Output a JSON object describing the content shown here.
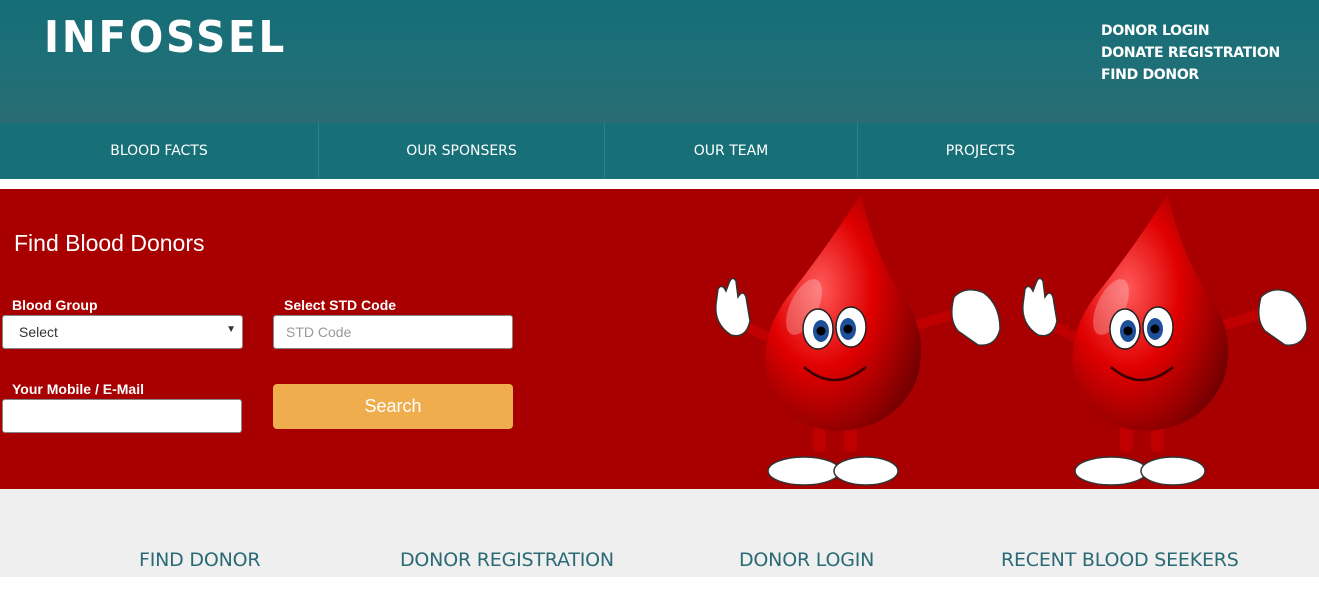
{
  "brand": {
    "logo_text": "INFOSSEL"
  },
  "top_links": [
    "DONOR LOGIN",
    "DONATE REGISTRATION",
    "FIND DONOR"
  ],
  "nav": [
    "BLOOD FACTS",
    "OUR SPONSERS",
    "OUR TEAM",
    "PROJECTS"
  ],
  "search_form": {
    "title": "Find Blood Donors",
    "blood_group_label": "Blood Group",
    "blood_group_selected": "Select",
    "std_label": "Select STD Code",
    "std_placeholder": "STD Code",
    "contact_label": "Your Mobile / E-Mail",
    "contact_value": "",
    "search_label": "Search"
  },
  "bottom_links": [
    "FIND DONOR",
    "DONOR REGISTRATION",
    "DONOR LOGIN",
    "RECENT BLOOD SEEKERS"
  ],
  "colors": {
    "header": "#176f78",
    "hero_bg": "#a80000",
    "search_button": "#f0ad4e",
    "bottom_bg": "#efefef",
    "bottom_link": "#2a6a75"
  },
  "icons": [
    "blood-drop-mascot-icon"
  ]
}
